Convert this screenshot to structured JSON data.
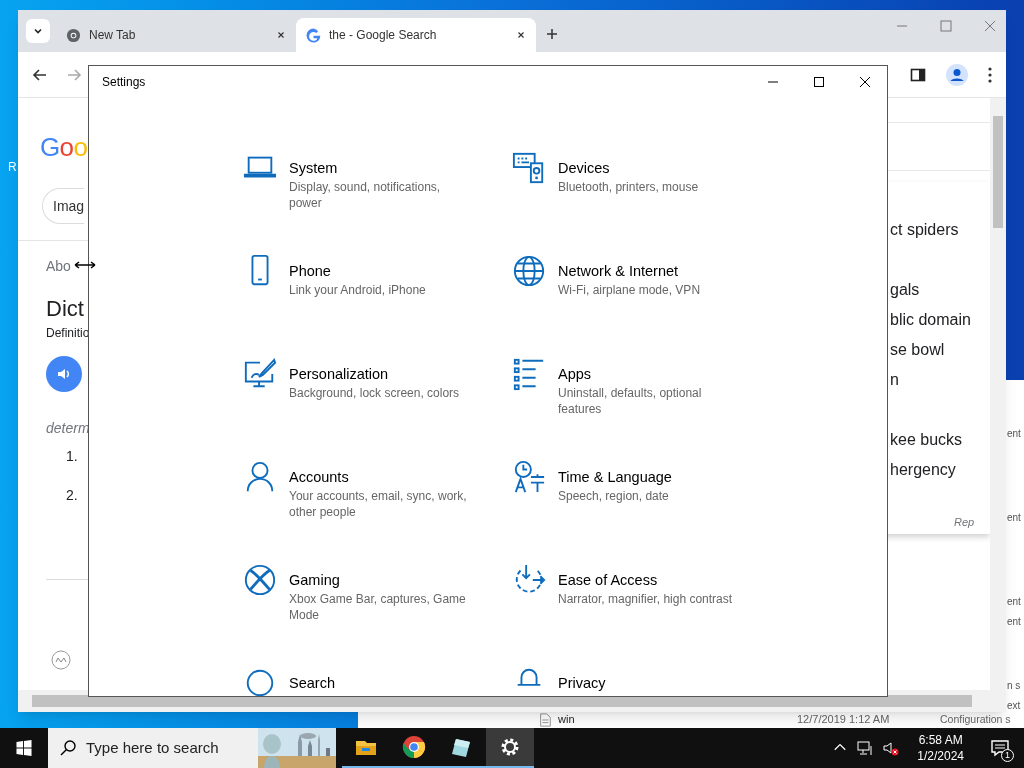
{
  "desktop": {
    "icon_label": "R"
  },
  "browser": {
    "tabs": [
      {
        "title": "New Tab",
        "selected": false,
        "kind": "newtab"
      },
      {
        "title": "the - Google Search",
        "selected": true,
        "kind": "google"
      }
    ],
    "page_left": {
      "logo": "Goo",
      "chip": "Imag",
      "about": "Abo",
      "heading": "Dict",
      "subheading": "Definitio",
      "phonetic": "determ",
      "numbers": [
        "1.",
        "2."
      ]
    },
    "page_right": {
      "lines": [
        "ct spiders",
        "gals",
        "blic domain",
        "se bowl",
        "n",
        "kee bucks",
        "hergency"
      ],
      "footer": "Rep"
    }
  },
  "explorer": {
    "fragments": [
      "ent",
      "ent",
      "ent",
      "ent",
      "n s",
      "ext"
    ],
    "row": {
      "name": "win",
      "date": "12/7/2019 1:12 AM",
      "type": "Configuration s"
    }
  },
  "settings": {
    "title": "Settings",
    "items": [
      {
        "kind": "system",
        "title": "System",
        "subtitle": "Display, sound, notifications, power"
      },
      {
        "kind": "devices",
        "title": "Devices",
        "subtitle": "Bluetooth, printers, mouse"
      },
      {
        "kind": "phone",
        "title": "Phone",
        "subtitle": "Link your Android, iPhone"
      },
      {
        "kind": "network",
        "title": "Network & Internet",
        "subtitle": "Wi-Fi, airplane mode, VPN"
      },
      {
        "kind": "personalization",
        "title": "Personalization",
        "subtitle": "Background, lock screen, colors"
      },
      {
        "kind": "apps",
        "title": "Apps",
        "subtitle": "Uninstall, defaults, optional features"
      },
      {
        "kind": "accounts",
        "title": "Accounts",
        "subtitle": "Your accounts, email, sync, work, other people"
      },
      {
        "kind": "time",
        "title": "Time & Language",
        "subtitle": "Speech, region, date"
      },
      {
        "kind": "gaming",
        "title": "Gaming",
        "subtitle": "Xbox Game Bar, captures, Game Mode"
      },
      {
        "kind": "ease",
        "title": "Ease of Access",
        "subtitle": "Narrator, magnifier, high contrast"
      },
      {
        "kind": "search",
        "title": "Search"
      },
      {
        "kind": "privacy",
        "title": "Privacy"
      }
    ]
  },
  "taskbar": {
    "search_placeholder": "Type here to search",
    "apps": [
      {
        "kind": "explorer",
        "active": false
      },
      {
        "kind": "chrome",
        "active": false
      },
      {
        "kind": "notepad",
        "active": false
      },
      {
        "kind": "settings",
        "active": true
      }
    ],
    "time": "6:58 AM",
    "date": "1/2/2024",
    "notification_count": "1"
  }
}
